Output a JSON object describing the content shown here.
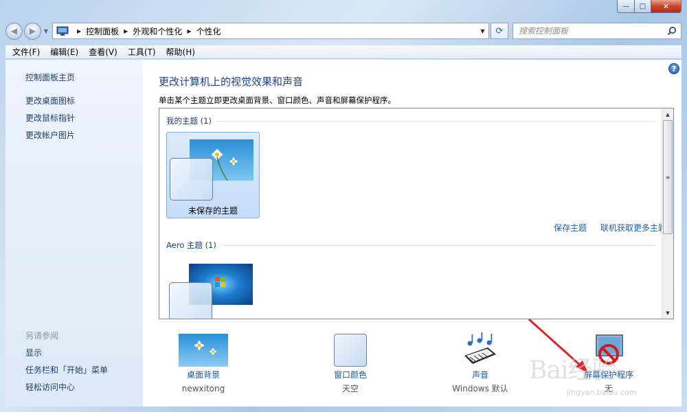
{
  "window": {
    "minimize": "—",
    "maximize": "□",
    "close": "✕"
  },
  "address": {
    "crumbs": [
      "控制面板",
      "外观和个性化",
      "个性化"
    ],
    "search_placeholder": "搜索控制面板"
  },
  "menu": [
    "文件(F)",
    "编辑(E)",
    "查看(V)",
    "工具(T)",
    "帮助(H)"
  ],
  "sidebar": {
    "links": [
      "控制面板主页",
      "更改桌面图标",
      "更改鼠标指针",
      "更改帐户图片"
    ],
    "see_also_label": "另请参阅",
    "see_also": [
      "显示",
      "任务栏和「开始」菜单",
      "轻松访问中心"
    ]
  },
  "main": {
    "help": "?",
    "title": "更改计算机上的视觉效果和声音",
    "subtitle": "单击某个主题立即更改桌面背景、窗口颜色、声音和屏幕保护程序。",
    "groups": [
      {
        "header": "我的主题 (1)",
        "themes": [
          {
            "label": "未保存的主题"
          }
        ]
      },
      {
        "header": "Aero 主题 (1)"
      }
    ],
    "save_theme": "保存主题",
    "get_more": "联机获取更多主题"
  },
  "shortcuts": [
    {
      "title": "桌面背景",
      "sub": "newxitong",
      "icon": "desktop-background-icon"
    },
    {
      "title": "窗口颜色",
      "sub": "天空",
      "icon": "window-color-icon"
    },
    {
      "title": "声音",
      "sub": "Windows 默认",
      "icon": "sound-icon"
    },
    {
      "title": "屏幕保护程序",
      "sub": "无",
      "icon": "screensaver-icon"
    }
  ],
  "watermark": {
    "text": "Bai经验",
    "url": "jingyan.baidu.com"
  },
  "colors": {
    "accent_link": "#1e55a5",
    "title_blue": "#1f3e8c",
    "selection": "#c4ddfa",
    "annotation_arrow": "#d9262d"
  }
}
